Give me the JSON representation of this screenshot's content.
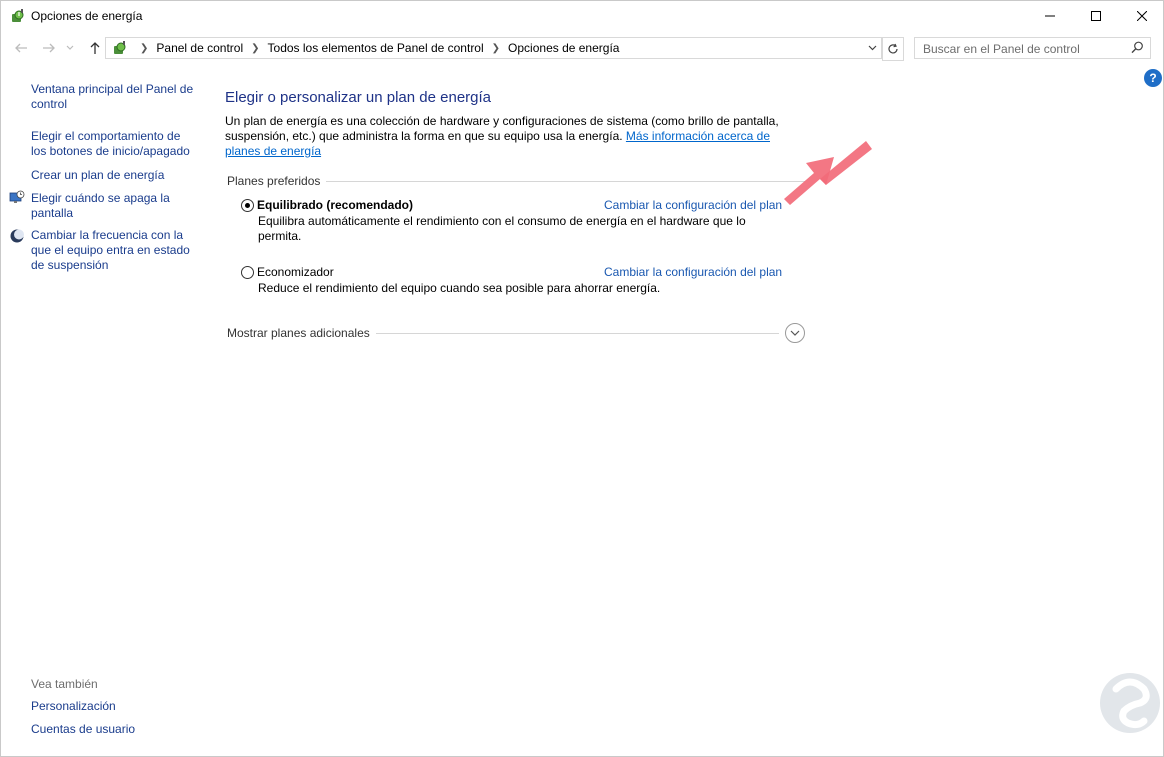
{
  "window": {
    "title": "Opciones de energía",
    "controls": [
      "minimize",
      "maximize",
      "close"
    ]
  },
  "navigation": {
    "breadcrumbs": [
      "Panel de control",
      "Todos los elementos de Panel de control",
      "Opciones de energía"
    ],
    "search_placeholder": "Buscar en el Panel de control"
  },
  "sidebar": {
    "links": [
      {
        "label_line1": "Ventana principal del Panel de",
        "label_line2": "control",
        "icon": null
      },
      {
        "label_line1": "Elegir el comportamiento de",
        "label_line2": "los botones de inicio/apagado",
        "icon": null
      },
      {
        "label_line1": "Crear un plan de energía",
        "label_line2": "",
        "icon": null
      },
      {
        "label_line1": "Elegir cuándo se apaga la",
        "label_line2": "pantalla",
        "icon": "monitor-clock-icon"
      },
      {
        "label_line1": "Cambiar la frecuencia con la",
        "label_line2": "que el equipo entra en estado",
        "label_line3": "de suspensión",
        "icon": "moon-sleep-icon"
      }
    ],
    "see_also_label": "Vea también",
    "see_also": [
      "Personalización",
      "Cuentas de usuario"
    ]
  },
  "main": {
    "heading": "Elegir o personalizar un plan de energía",
    "intro_text": "Un plan de energía es una colección de hardware y configuraciones de sistema (como brillo de pantalla, suspensión, etc.) que administra la forma en que su equipo usa la energía.",
    "intro_link": "Más información acerca de planes de energía",
    "section_label": "Planes preferidos",
    "plans": [
      {
        "name": "Equilibrado (recomendado)",
        "selected": true,
        "change_link": "Cambiar la configuración del plan",
        "description": "Equilibra automáticamente el rendimiento con el consumo de energía en el hardware que lo permita."
      },
      {
        "name": "Economizador",
        "selected": false,
        "change_link": "Cambiar la configuración del plan",
        "description": "Reduce el rendimiento del equipo cuando sea posible para ahorrar energía."
      }
    ],
    "more_plans_label": "Mostrar planes adicionales"
  },
  "colors": {
    "heading": "#1e3287",
    "link": "#1a58b0",
    "annotation_arrow": "#f26b7a"
  }
}
